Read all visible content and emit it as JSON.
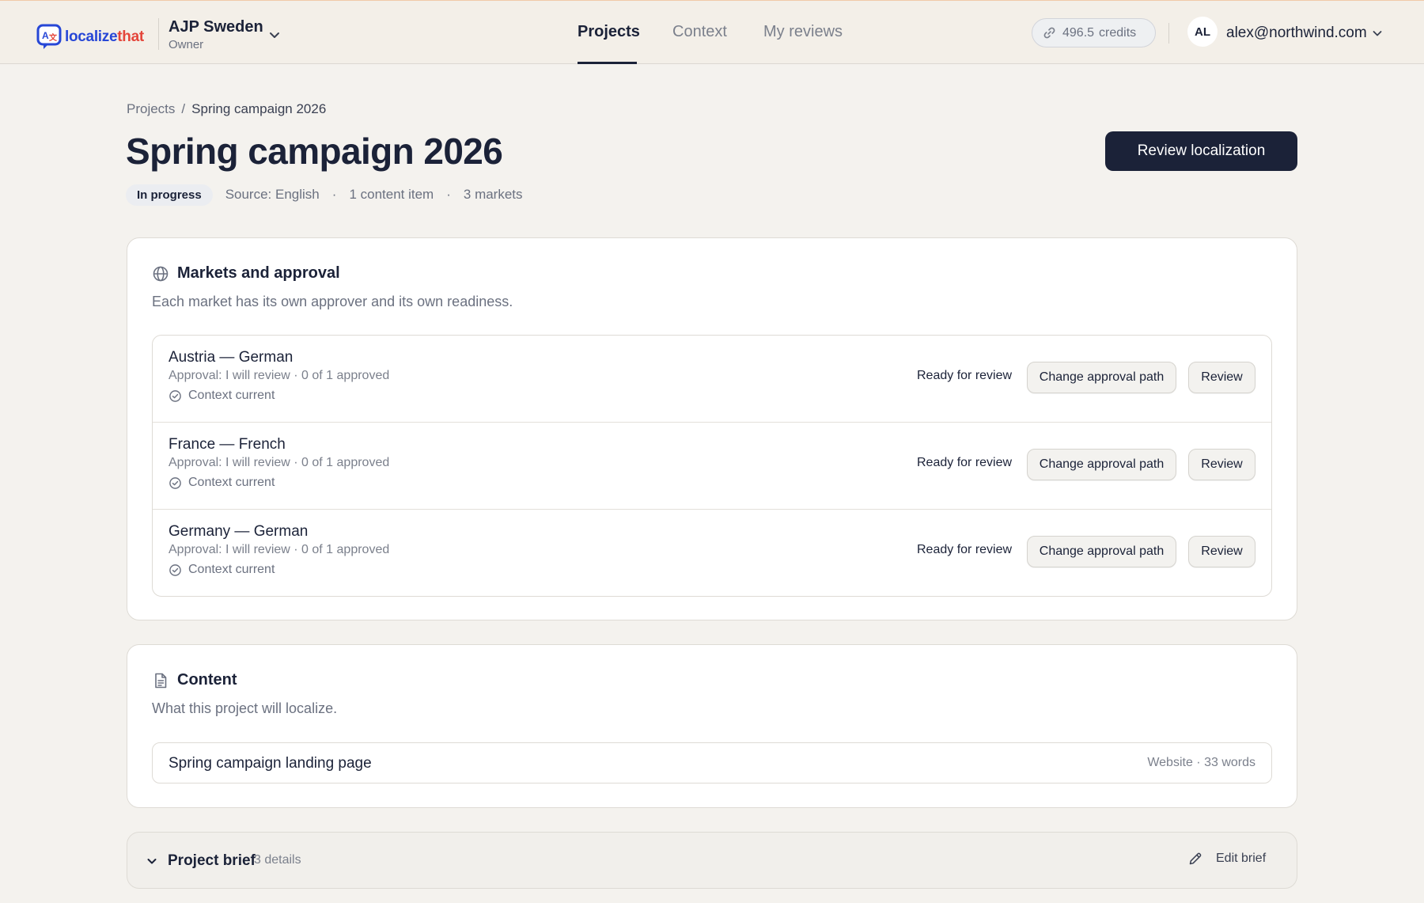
{
  "app": {
    "logo_part1": "localize",
    "logo_part2": "that",
    "org_name": "AJP Sweden",
    "org_role": "Owner"
  },
  "nav": {
    "tabs": [
      {
        "label": "Projects",
        "active": true
      },
      {
        "label": "Context",
        "active": false
      },
      {
        "label": "My reviews",
        "active": false
      }
    ]
  },
  "account": {
    "credits_value": "496.5",
    "credits_label": "credits",
    "avatar_initials": "AL",
    "email": "alex@northwind.com"
  },
  "breadcrumb": {
    "root": "Projects",
    "separator": "/",
    "current": "Spring campaign 2026"
  },
  "page": {
    "title": "Spring campaign 2026",
    "primary_action": "Review localization",
    "status": "In progress",
    "source": "Source: English",
    "content_count": "1 content item",
    "markets_count": "3 markets",
    "separator": "·"
  },
  "markets": {
    "title": "Markets and approval",
    "subtitle": "Each market has its own approver and its own readiness.",
    "rows": [
      {
        "name": "Austria — German",
        "approval": "Approval: I will review · 0 of 1 approved",
        "context": "Context current",
        "status": "Ready for review",
        "change_label": "Change approval path",
        "review_label": "Review"
      },
      {
        "name": "France — French",
        "approval": "Approval: I will review · 0 of 1 approved",
        "context": "Context current",
        "status": "Ready for review",
        "change_label": "Change approval path",
        "review_label": "Review"
      },
      {
        "name": "Germany — German",
        "approval": "Approval: I will review · 0 of 1 approved",
        "context": "Context current",
        "status": "Ready for review",
        "change_label": "Change approval path",
        "review_label": "Review"
      }
    ]
  },
  "content": {
    "title": "Content",
    "subtitle": "What this project will localize.",
    "items": [
      {
        "name": "Spring campaign landing page",
        "meta": "Website · 33 words"
      }
    ]
  },
  "brief": {
    "title": "Project brief",
    "count": "3 details",
    "edit_label": "Edit brief"
  },
  "colors": {
    "brand_blue": "#2747d6",
    "brand_red": "#e4453a",
    "primary_dark": "#1b2238",
    "page_bg": "#f4f2ee"
  },
  "icons": [
    "speech-bubble-translate-logo",
    "chevron-down-icon",
    "link-icon",
    "globe-icon",
    "check-circle-icon",
    "document-icon",
    "pencil-icon"
  ]
}
